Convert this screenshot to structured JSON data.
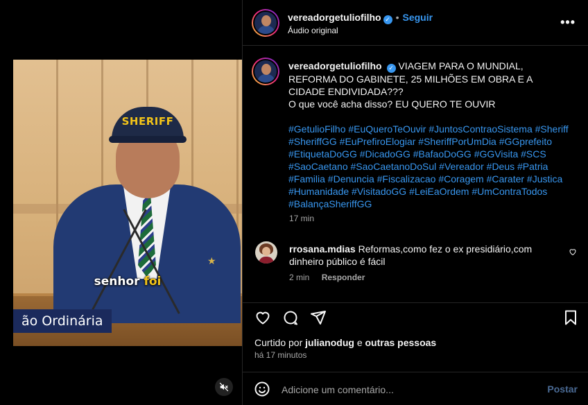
{
  "media": {
    "cap_text": "SHERIFF",
    "subtitle_white": "senhor",
    "subtitle_yellow": "foi",
    "lower_third": "ão Ordinária",
    "mute_icon": "volume-muted-icon"
  },
  "post": {
    "author": "vereadorgetuliofilho",
    "separator": "•",
    "follow_label": "Seguir",
    "audio_label": "Áudio original",
    "more_icon": "•••"
  },
  "caption": {
    "author": "vereadorgetuliofilho",
    "text_line1": "VIAGEM PARA O MUNDIAL, REFORMA DO GABINETE, 25 MILHÕES EM OBRA E A CIDADE ENDIVIDADA???",
    "text_line2": "O que você acha disso? EU QUERO TE OUVIR",
    "hashtags": "#GetulioFilho #EuQueroTeOuvir #JuntosContraoSistema #Sheriff #SheriffGG #EuPrefiroElogiar #SheriffPorUmDia #GGprefeito #EtiquetaDoGG #DicadoGG #BafaoDoGG #GGVisita #SCS #SaoCaetano #SaoCaetanoDoSul #Vereador #Deus #Patria #Familia #Denuncia #Fiscalizacao #Coragem #Carater #Justica #Humanidade #VisitadoGG #LeiEaOrdem #UmContraTodos #BalançaSheriffGG",
    "time": "17 min"
  },
  "comment": {
    "author": "rrosana.mdias",
    "text": "Reformas,como fez o ex presidiário,com dinheiro público é fácil",
    "time": "2 min",
    "reply_label": "Responder"
  },
  "likes": {
    "prefix": "Curtido por",
    "user": "julianodug",
    "connector": "e",
    "others": "outras pessoas"
  },
  "posted_time": "há 17 minutos",
  "add_comment": {
    "placeholder": "Adicione um comentário...",
    "post_label": "Postar"
  },
  "colors": {
    "background": "#000000",
    "text": "#f5f5f5",
    "secondary_text": "#a8a8a8",
    "link": "#3897f0",
    "divider": "#262626"
  }
}
